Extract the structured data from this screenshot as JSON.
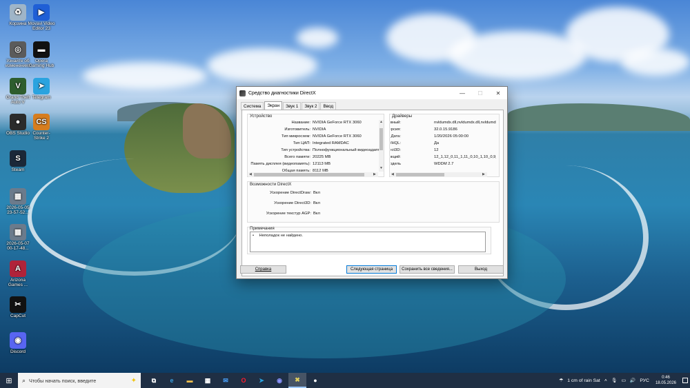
{
  "desktop": {
    "icons": [
      {
        "label": "Корзина",
        "color": "#9fb5c8",
        "glyph": "♻"
      },
      {
        "label": "Movavi Video Editor 23",
        "color": "#1f5fd6",
        "glyph": "▶"
      },
      {
        "label": "Узнайте об изменениях",
        "color": "#5b5b5b",
        "glyph": "◎"
      },
      {
        "label": "Opera Gaming Hub",
        "color": "#111111",
        "glyph": "▬"
      },
      {
        "label": "Grand Theft Auto V",
        "color": "#2e5d2e",
        "glyph": "V"
      },
      {
        "label": "Telegram",
        "color": "#2aa3df",
        "glyph": "➤"
      },
      {
        "label": "OBS Studio",
        "color": "#2b2b2b",
        "glyph": "●"
      },
      {
        "label": "Counter-Strike 2",
        "color": "#d67d1f",
        "glyph": "CS"
      },
      {
        "label": "Steam",
        "color": "#1b2838",
        "glyph": "S"
      },
      {
        "label": "2026-05-05 23-57-52...",
        "color": "#6b7b8c",
        "glyph": "▦"
      },
      {
        "label": "2026-05-07 00-17-48...",
        "color": "#6b7b8c",
        "glyph": "▦"
      },
      {
        "label": "Arizona Games ...",
        "color": "#b0233a",
        "glyph": "A"
      },
      {
        "label": "CapCut",
        "color": "#111111",
        "glyph": "✂"
      },
      {
        "label": "Discord",
        "color": "#5865f2",
        "glyph": "◉"
      }
    ]
  },
  "window": {
    "title": "Средство диагностики DirectX",
    "controls": {
      "minimize": "—",
      "maximize": "☐",
      "close": "✕"
    },
    "tabs": [
      "Система",
      "Экран",
      "Звук 1",
      "Звук 2",
      "Ввод"
    ],
    "active_tab": "Экран",
    "device": {
      "group_label": "Устройство",
      "rows": [
        {
          "key": "Название:",
          "value": "NVIDIA GeForce RTX 3060"
        },
        {
          "key": "Изготовитель:",
          "value": "NVIDIA"
        },
        {
          "key": "Тип микросхем:",
          "value": "NVIDIA GeForce RTX 3060"
        },
        {
          "key": "Тип ЦАП:",
          "value": "Integrated RAMDAC"
        },
        {
          "key": "Тип устройства:",
          "value": "Полнофункциональный видеоадапт"
        },
        {
          "key": "Всего памяти:",
          "value": "20225 MB"
        },
        {
          "key": "Память дисплея (видеопамять):",
          "value": "12113 MB"
        },
        {
          "key": "Общая память:",
          "value": "8112 MB"
        }
      ]
    },
    "drivers": {
      "group_label": "Драйверы",
      "rows": [
        {
          "key": "Главный:",
          "value": "nvldumdx.dll,nvldumdx.dll,nvldumdx.d"
        },
        {
          "key": "Версия:",
          "value": "32.0.15.9186"
        },
        {
          "key": "Дата:",
          "value": "1/20/2026 05:00:00"
        },
        {
          "key": "Подпись WHQL:",
          "value": "Да"
        },
        {
          "key": "DDI для Direct3D:",
          "value": "12"
        },
        {
          "key": "Уровни функций:",
          "value": "12_1,12_0,11_1,11_0,10_1,10_0,9_"
        },
        {
          "key": "Модель",
          "value": "WDDM 2.7"
        }
      ]
    },
    "directx_features": {
      "group_label": "Возможности DirectX",
      "rows": [
        {
          "key": "Ускорение DirectDraw:",
          "value": "Вкл"
        },
        {
          "key": "Ускорение Direct3D:",
          "value": "Вкл"
        },
        {
          "key": "Ускорение текстур AGP:",
          "value": "Вкл"
        }
      ]
    },
    "notes": {
      "group_label": "Примечания",
      "text": "Неполадок не найдено."
    },
    "buttons": {
      "help": "Справка",
      "next_page": "Следующая страница",
      "save_all": "Сохранить все сведения...",
      "exit": "Выход"
    }
  },
  "taskbar": {
    "search_placeholder": "Чтобы начать поиск, введите",
    "apps": [
      {
        "name": "task-view",
        "glyph": "⧉",
        "color": "#ffffff"
      },
      {
        "name": "edge",
        "glyph": "e",
        "color": "#3aa0e0"
      },
      {
        "name": "explorer",
        "glyph": "▬",
        "color": "#f2c14e"
      },
      {
        "name": "store",
        "glyph": "▦",
        "color": "#ffffff"
      },
      {
        "name": "mail",
        "glyph": "✉",
        "color": "#4aa3ff"
      },
      {
        "name": "opera",
        "glyph": "O",
        "color": "#ff1b2d"
      },
      {
        "name": "telegram",
        "glyph": "➤",
        "color": "#2aa3df"
      },
      {
        "name": "discord",
        "glyph": "◉",
        "color": "#8c95ff"
      },
      {
        "name": "directx",
        "glyph": "✖",
        "color": "#e0d060"
      },
      {
        "name": "obs",
        "glyph": "●",
        "color": "#ffffff"
      }
    ],
    "weather": "1 cm of rain Sat",
    "language": "РУС",
    "time": "0:46",
    "date": "18.05.2026"
  }
}
